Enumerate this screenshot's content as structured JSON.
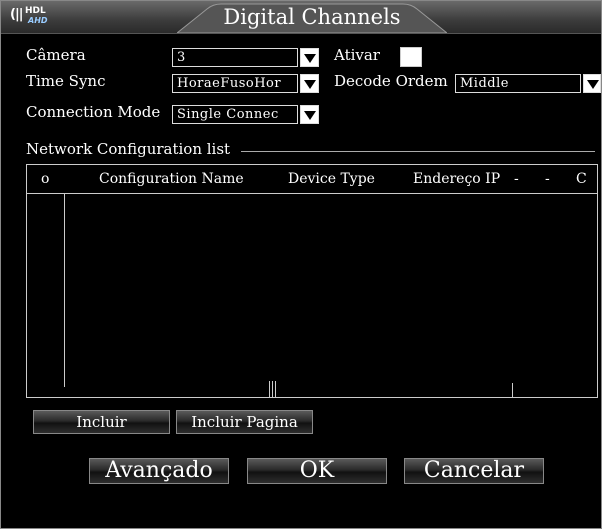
{
  "window": {
    "title": "Digital Channels"
  },
  "logo": {
    "brand": "HDL",
    "sub": "AHD"
  },
  "camera": {
    "label": "Câmera",
    "value": "3"
  },
  "ativar": {
    "label": "Ativar",
    "checked": false
  },
  "time_sync": {
    "label": "Time Sync",
    "value": "HoraeFusoHor"
  },
  "decode": {
    "label": "Decode Ordem",
    "value": "Middle"
  },
  "connection_mode": {
    "label": "Connection Mode",
    "value": "Single Connec"
  },
  "network": {
    "group_label": "Network Configuration list",
    "columns": [
      "o",
      "Configuration Name",
      "Device Type",
      "Endereço IP",
      "-",
      "-",
      "C"
    ],
    "rows": []
  },
  "buttons": {
    "incluir": "Incluir",
    "incluir_pagina": "Incluir Pagina",
    "avancado": "Avançado",
    "ok": "OK",
    "cancelar": "Cancelar"
  },
  "colors": {
    "background": "#000000",
    "text": "#ffffff",
    "border": "#cccccc"
  }
}
